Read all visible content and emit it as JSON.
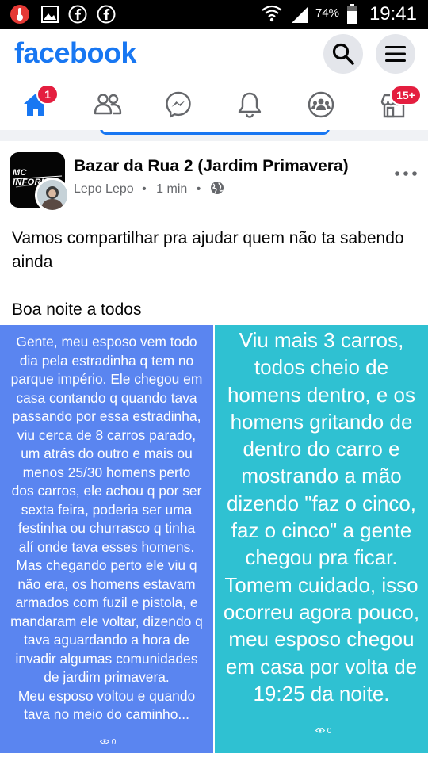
{
  "status_bar": {
    "battery_percent": "74%",
    "clock": "19:41",
    "icons": [
      "temperature-icon",
      "gallery-icon",
      "facebook-icon",
      "facebook-icon",
      "wifi-icon",
      "signal-icon",
      "battery-icon"
    ]
  },
  "header": {
    "logo": "facebook",
    "search_icon": "search-icon",
    "menu_icon": "menu-icon"
  },
  "nav": {
    "items": [
      {
        "icon": "home-icon",
        "badge": "1",
        "active": true
      },
      {
        "icon": "friends-icon"
      },
      {
        "icon": "messenger-icon"
      },
      {
        "icon": "bell-icon"
      },
      {
        "icon": "groups-icon"
      },
      {
        "icon": "marketplace-icon",
        "badge": "15+"
      }
    ]
  },
  "post": {
    "group_name": "Bazar da Rua 2 (Jardim Primavera)",
    "author": "Lepo Lepo",
    "time": "1 min",
    "separator": "•",
    "privacy_icon": "globe-icon",
    "group_avatar_text": "MC INFORMA",
    "text_lines": [
      "Vamos compartilhar pra ajudar quem não ta sabendo ainda",
      "Boa noite a todos"
    ],
    "images": [
      {
        "lines": [
          "Gente, meu esposo vem todo",
          "dia pela estradinha q tem no",
          "parque império. Ele chegou em",
          "casa contando q quando tava",
          "passando por essa estradinha,",
          "viu cerca de 8 carros parado,",
          "um atrás do outro e mais ou",
          "menos 25/30 homens perto",
          "dos carros, ele achou q por ser",
          "sexta feira, poderia ser uma",
          "festinha ou churrasco q tinha",
          "alí onde tava esses homens.",
          "Mas chegando perto ele viu q",
          "não era, os homens estavam",
          "armados com fuzil e pistola, e",
          "mandaram ele voltar, dizendo q",
          "tava aguardando a hora de",
          "invadir algumas comunidades",
          "de jardim primavera.",
          "Meu esposo voltou e quando",
          "tava no meio do caminho..."
        ],
        "views": "0"
      },
      {
        "lines": [
          "Viu mais 3 carros,",
          "todos cheio de",
          "homens dentro, e os",
          "homens gritando de",
          "dentro do carro e",
          "mostrando a mão",
          "dizendo \"faz o cinco,",
          "faz o cinco\"  a gente",
          "chegou pra ficar.",
          "Tomem cuidado, isso",
          "ocorreu agora pouco,",
          "meu esposo chegou",
          "em casa por volta de",
          "19:25 da noite."
        ],
        "views": "0"
      }
    ]
  },
  "colors": {
    "brand": "#1877f2",
    "badge": "#e41e3f",
    "image_left_bg": "#5a85f0",
    "image_right_bg": "#2fc1d2"
  }
}
